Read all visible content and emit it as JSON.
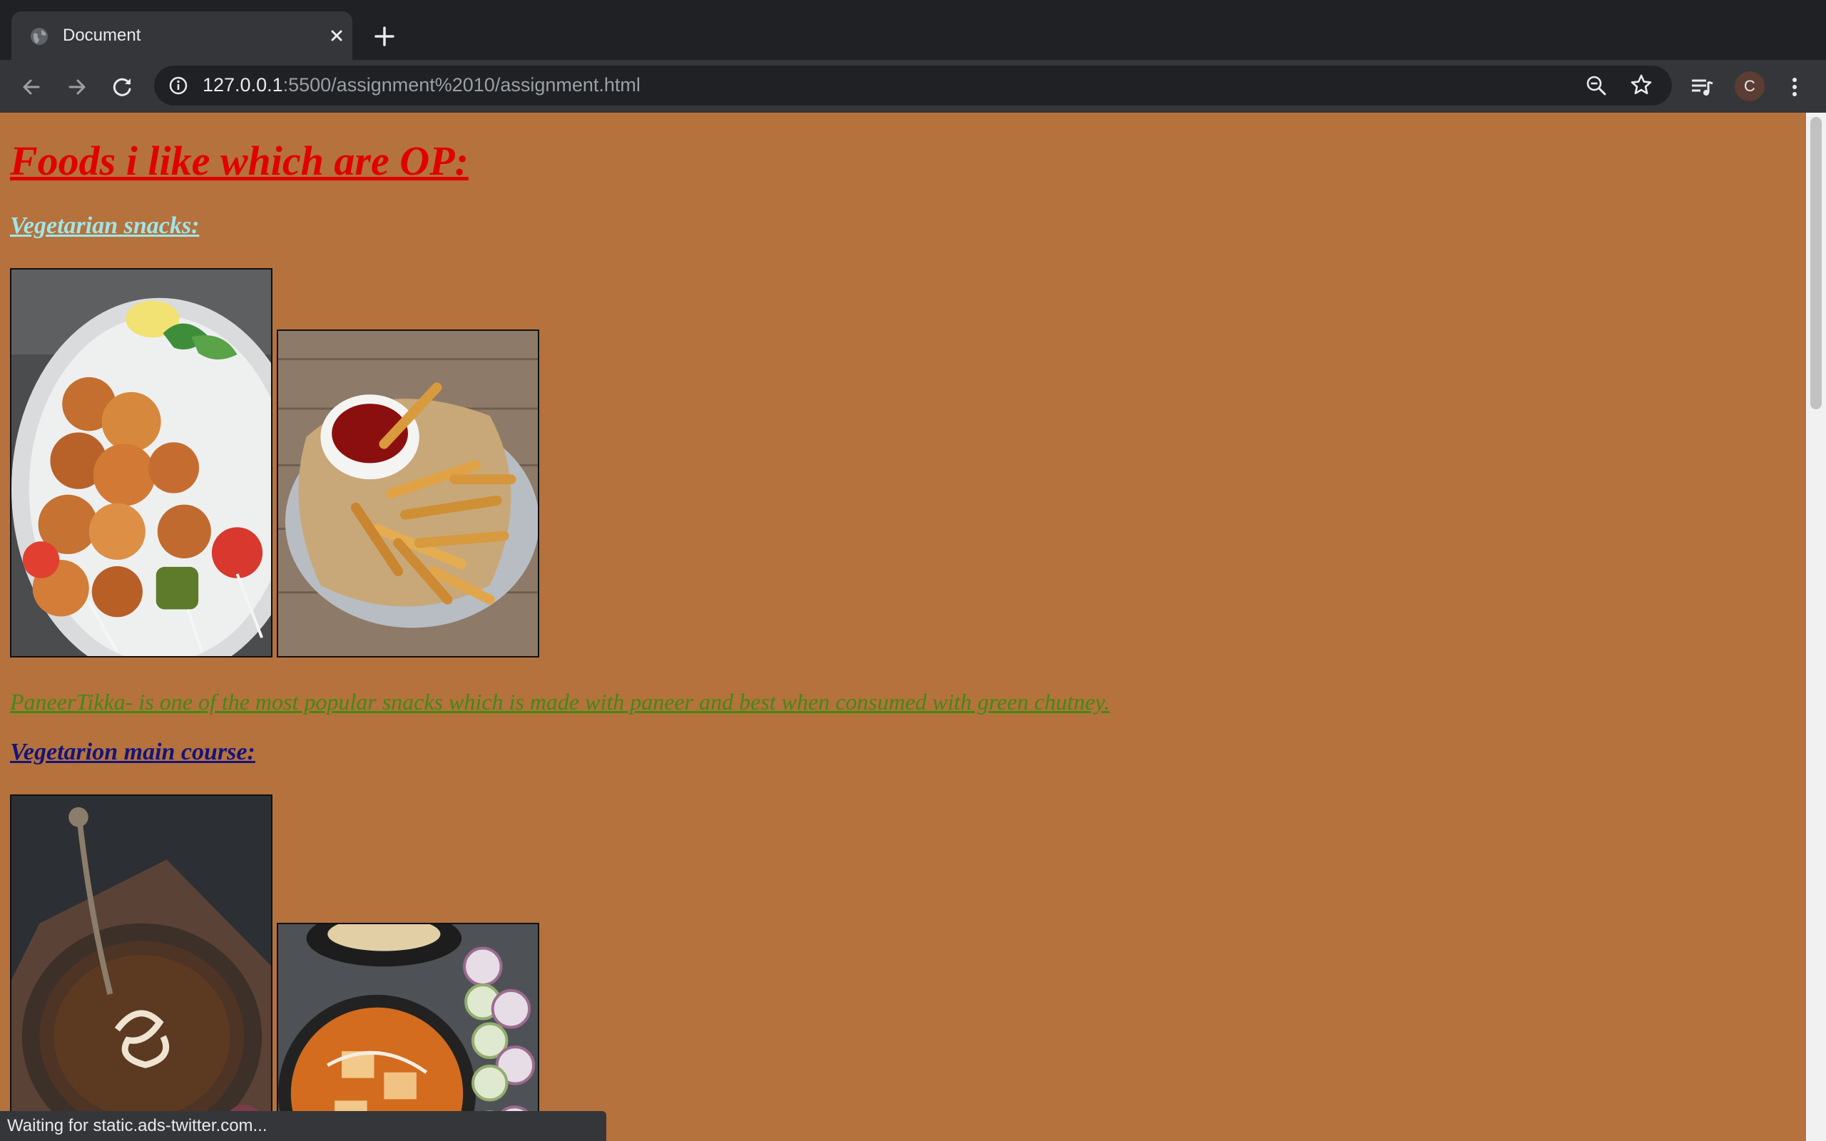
{
  "browser": {
    "tab_title": "Document",
    "url_host": "127.0.0.1",
    "url_path": ":5500/assignment%2010/assignment.html",
    "profile_initial": "C",
    "status_text": "Waiting for static.ads-twitter.com..."
  },
  "page": {
    "heading": "Foods i like which are OP:",
    "snacks_heading": "Vegetarian snacks:",
    "snacks_description": "PaneerTikka- is one of the most popular snacks which is made with paneer and best when consumed with green chutney.",
    "main_course_heading": "Vegetarion main course:",
    "background_color": "#b5723d",
    "heading_color": "#e00000",
    "snacks_heading_color": "#9fe5ea",
    "description_color": "#3f8a16",
    "main_course_heading_color": "#14147a"
  },
  "icons": {
    "tab_favicon": "globe-icon",
    "tab_close": "close-icon",
    "new_tab": "plus-icon",
    "back": "back-arrow-icon",
    "forward": "forward-arrow-icon",
    "reload": "reload-icon",
    "site_info": "info-icon",
    "zoom": "zoom-out-icon",
    "bookmark": "star-icon",
    "media": "media-queue-icon",
    "menu": "kebab-menu-icon"
  }
}
